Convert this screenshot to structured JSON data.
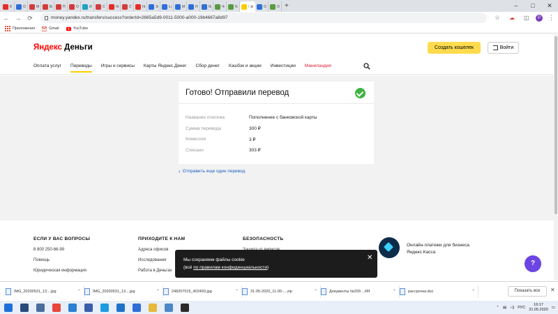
{
  "browser": {
    "tabs": [
      {
        "label": "8 и",
        "color": "#e52d27"
      },
      {
        "label": "Обр",
        "color": "#2f6fd6"
      },
      {
        "label": "МБ",
        "color": "#d23c3c"
      },
      {
        "label": "Бил",
        "color": "#d23c3c"
      },
      {
        "label": "Пор",
        "color": "#d23c3c"
      },
      {
        "label": "ООО",
        "color": "#d23c3c"
      },
      {
        "label": "Ин",
        "color": "#1ca2c4"
      },
      {
        "label": "Ста",
        "color": "#d23c3c"
      },
      {
        "label": "http",
        "color": "#e52d27"
      },
      {
        "label": "Ста",
        "color": "#d23c3c"
      },
      {
        "label": "http",
        "color": "#e52d27"
      },
      {
        "label": "Зоо",
        "color": "#2f6fd6"
      },
      {
        "label": "Loca",
        "color": "#2f6fd6"
      },
      {
        "label": "Ма",
        "color": "#2f6fd6"
      },
      {
        "label": "Ноя",
        "color": "#2f6fd6"
      },
      {
        "label": "IMC",
        "color": "#2f6fd6"
      },
      {
        "label": "Чер",
        "color": "#5a9b42"
      },
      {
        "label": "NEV",
        "color": "#5a9b42"
      },
      {
        "label": "Я",
        "color": "#ffcc00",
        "active": true
      },
      {
        "label": "ОВП",
        "color": "#2f6fd6"
      },
      {
        "label": "Они",
        "color": "#5a9b42"
      }
    ],
    "url": "money.yandex.ru/transfers/success?orderId=2665a5d9-0011-5000-a000-19b4667a8d97",
    "profile_letter": "P",
    "bookmarks": [
      {
        "label": "Приложения",
        "icon": "apps-grid-icon"
      },
      {
        "label": "Gmail",
        "icon": "gmail-icon"
      },
      {
        "label": "YouTube",
        "icon": "youtube-icon"
      }
    ]
  },
  "header": {
    "logo_brand": "Яндекс",
    "logo_product": "Деньги",
    "create_wallet": "Создать кошелек",
    "login": "Войти",
    "nav": [
      {
        "label": "Оплата услуг"
      },
      {
        "label": "Переводы",
        "active": true
      },
      {
        "label": "Игры и сервисы"
      },
      {
        "label": "Карты Яндекс.Денег"
      },
      {
        "label": "Сбор денег"
      },
      {
        "label": "Кэшбэк и акции"
      },
      {
        "label": "Инвестиции"
      },
      {
        "label": "Манилэндия",
        "red": true
      }
    ]
  },
  "result": {
    "title": "Готово! Отправили перевод",
    "rows": [
      {
        "key": "Название платежа",
        "value": "Пополнение с банковской карты"
      },
      {
        "key": "Сумма перевода",
        "value": "300 ₽"
      },
      {
        "key": "Комиссия",
        "value": "3 ₽"
      },
      {
        "key": "Списано",
        "value": "303 ₽"
      }
    ],
    "another_link": "Отправить еще один перевод"
  },
  "footer": {
    "cols": [
      {
        "title": "ЕСЛИ У ВАС ВОПРОСЫ",
        "links": [
          "8 800 250-66-99",
          "Помощь",
          "Юридическая информация"
        ]
      },
      {
        "title": "ПРИХОДИТЕ К НАМ",
        "links": [
          "Адреса офисов",
          "Исследования",
          "Работа в Деньгах"
        ]
      },
      {
        "title": "БЕЗОПАСНОСТЬ",
        "links": [
          "Защита от вирусов"
        ]
      }
    ],
    "kassa_text": "Онлайн-платежи для бизнеса. Яндекс.Касса",
    "help": "?",
    "cookie_line1": "Мы сохраняем файлы cookie",
    "cookie_prefix": "(всё ",
    "cookie_link": "по правилам конфиденциальности",
    "cookie_suffix": ")"
  },
  "downloads": {
    "items": [
      {
        "name": "IMG_20200531_13....jpg"
      },
      {
        "name": "IMG_20200531_13....jpg"
      },
      {
        "name": "248207015_402493.jpg"
      },
      {
        "name": "31-05-2020_11-00-....zip"
      },
      {
        "name": "Документы №209....Rtf"
      },
      {
        "name": "рассрочка.doc"
      }
    ],
    "show_all": "Показать все"
  },
  "taskbar": {
    "apps": [
      {
        "name": "windows-start-icon",
        "color": "#1e6fd9"
      },
      {
        "name": "search-icon",
        "color": "#2a4a7a"
      },
      {
        "name": "camera-icon",
        "color": "#4a6d9c"
      },
      {
        "name": "chrome-icon",
        "color": "#e8453c"
      },
      {
        "name": "store-icon",
        "color": "#2c7fd3"
      },
      {
        "name": "files-icon",
        "color": "#3a5ea8"
      },
      {
        "name": "skype-icon",
        "color": "#1b9ce0"
      },
      {
        "name": "edge-icon",
        "color": "#1f72c9"
      },
      {
        "name": "mail-icon",
        "color": "#2f6fd6"
      },
      {
        "name": "folder-icon",
        "color": "#e6b93a"
      },
      {
        "name": "photos-icon",
        "color": "#4a88c6"
      },
      {
        "name": "terminal-icon",
        "color": "#2b2b2b"
      }
    ],
    "lang": "РУС",
    "time": "16:17",
    "date": "31.05.2020"
  }
}
